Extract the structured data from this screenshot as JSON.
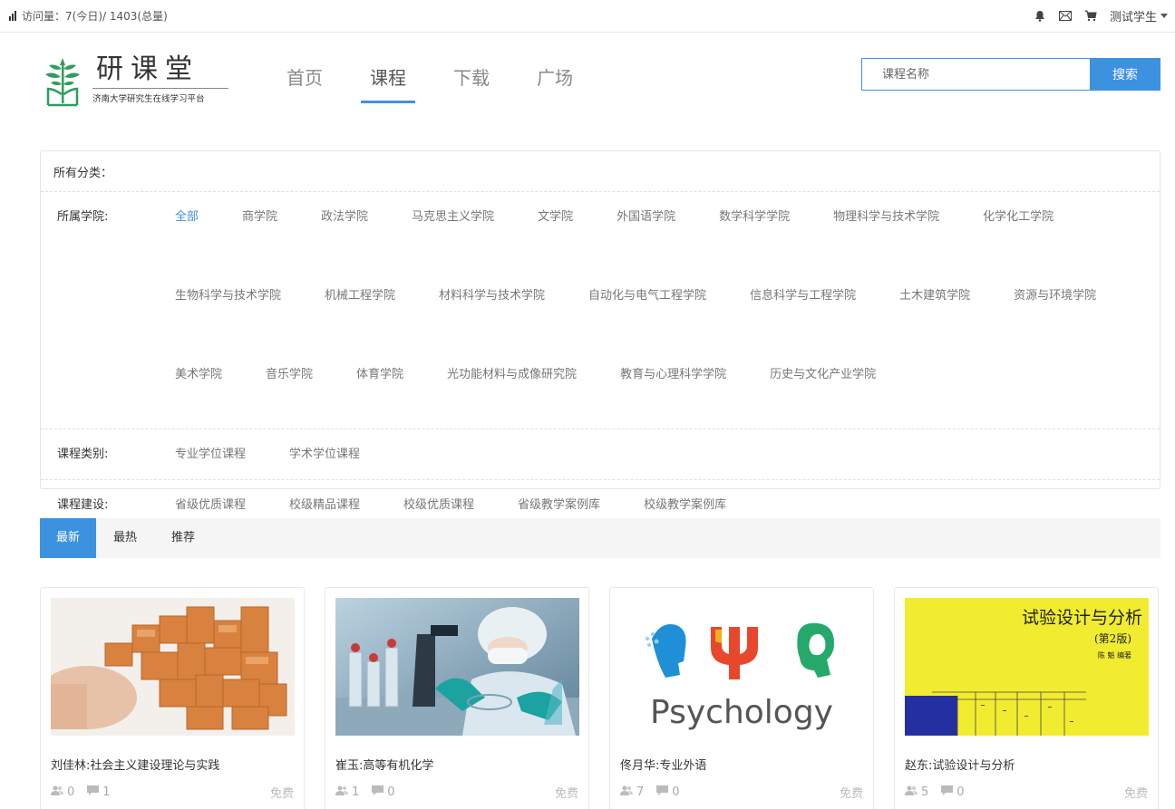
{
  "topbar": {
    "visits": "访问量：7(今日)/ 1403(总量)",
    "user": "测试学生"
  },
  "logo": {
    "title": "研课堂",
    "subtitle": "济南大学研究生在线学习平台"
  },
  "nav": {
    "items": [
      "首页",
      "课程",
      "下载",
      "广场"
    ],
    "active": "课程"
  },
  "search": {
    "placeholder": "课程名称",
    "button": "搜索"
  },
  "filter": {
    "all_label": "所有分类：",
    "college": {
      "label": "所属学院:",
      "options": [
        "全部",
        "商学院",
        "政法学院",
        "马克思主义学院",
        "文学院",
        "外国语学院",
        "数学科学学院",
        "物理科学与技术学院",
        "化学化工学院",
        "生物科学与技术学院",
        "机械工程学院",
        "材料科学与技术学院",
        "自动化与电气工程学院",
        "信息科学与工程学院",
        "土木建筑学院",
        "资源与环境学院",
        "美术学院",
        "音乐学院",
        "体育学院",
        "光功能材料与成像研究院",
        "教育与心理科学学院",
        "历史与文化产业学院"
      ],
      "selected": "全部"
    },
    "category": {
      "label": "课程类别:",
      "options": [
        "专业学位课程",
        "学术学位课程"
      ]
    },
    "construction": {
      "label": "课程建设:",
      "options": [
        "省级优质课程",
        "校级精品课程",
        "校级优质课程",
        "省级教学案例库",
        "校级教学案例库"
      ]
    }
  },
  "sort_tabs": {
    "items": [
      "最新",
      "最热",
      "推荐"
    ],
    "active": "最新"
  },
  "courses": [
    {
      "title": "刘佳林:社会主义建设理论与实践",
      "students": "0",
      "comments": "1",
      "price": "免费",
      "image": "wooden-puzzle"
    },
    {
      "title": "崔玉:高等有机化学",
      "students": "1",
      "comments": "0",
      "price": "免费",
      "image": "chemistry-lab"
    },
    {
      "title": "佟月华:专业外语",
      "students": "7",
      "comments": "0",
      "price": "免费",
      "image_text": "Psychology",
      "image": "psychology-logo"
    },
    {
      "title": "赵东:试验设计与分析",
      "students": "5",
      "comments": "0",
      "price": "免费",
      "image_text": "试验设计与分析",
      "image_edition": "(第2版)",
      "image_author": "陈 魁 编著",
      "image": "book-cover"
    }
  ],
  "colors": {
    "accent": "#3d92e0",
    "logo_green": "#2f9e5b"
  }
}
